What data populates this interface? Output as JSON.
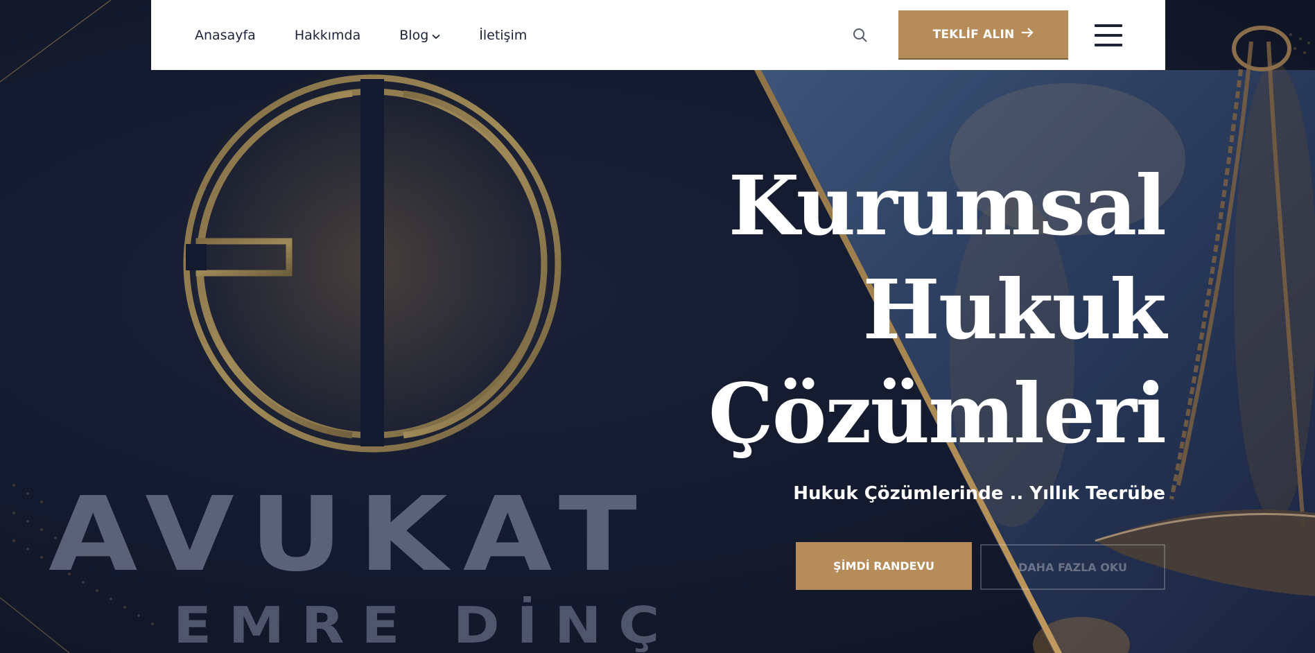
{
  "nav": {
    "items": [
      {
        "label": "Anasayfa"
      },
      {
        "label": "Hakkımda"
      },
      {
        "label": "Blog"
      },
      {
        "label": "İletişim"
      }
    ],
    "quote_button": "TEKLİF ALIN"
  },
  "hero": {
    "headline": [
      "Kurumsal",
      "Hukuk",
      "Çözümleri"
    ],
    "subtitle": "Hukuk Çözümlerinde .. Yıllık Tecrübe",
    "primary_button": "ŞİMDİ RANDEVU",
    "secondary_button": "DAHA FAZLA OKU"
  },
  "logo": {
    "title": "AVUKAT",
    "name": "EMRE DİNÇ"
  },
  "colors": {
    "accent": "#b68d5a",
    "background": "#14192c",
    "nav_text": "#1d2337"
  }
}
